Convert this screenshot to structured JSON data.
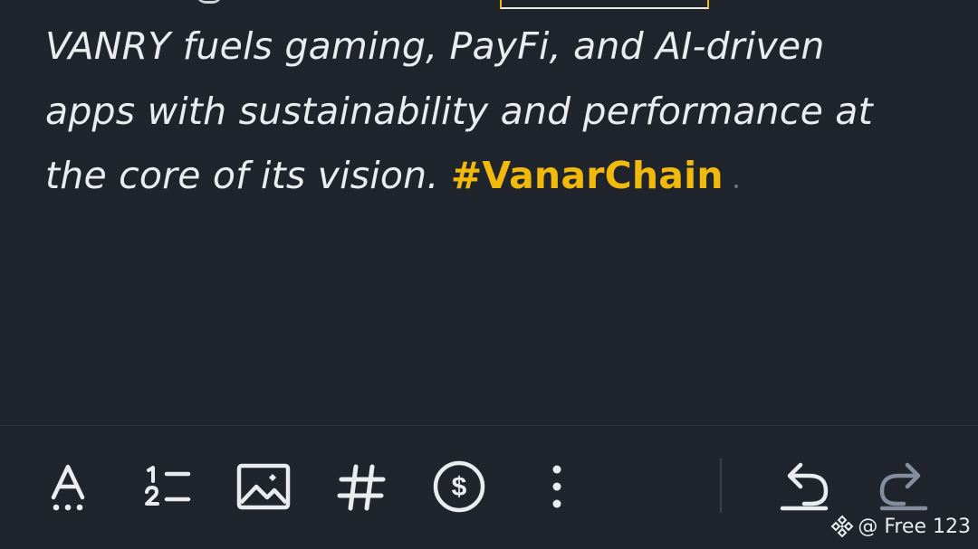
{
  "editor": {
    "line1": "VANRY fuels gaming, PayFi, and AI-driven",
    "line2": "apps with sustainability and performance at",
    "line3": "the core of its vision.",
    "hashtag": "#VanarChain"
  },
  "toolbar": {
    "icons": [
      "text-format-icon",
      "numbered-list-icon",
      "image-icon",
      "hashtag-icon",
      "coin-icon",
      "more-icon",
      "undo-icon",
      "redo-icon"
    ]
  },
  "watermark": {
    "text": "@ Free 123"
  },
  "colors": {
    "background": "#1f242d",
    "text": "#eaecef",
    "accent": "#f0b90b",
    "muted": "#848e9c"
  }
}
